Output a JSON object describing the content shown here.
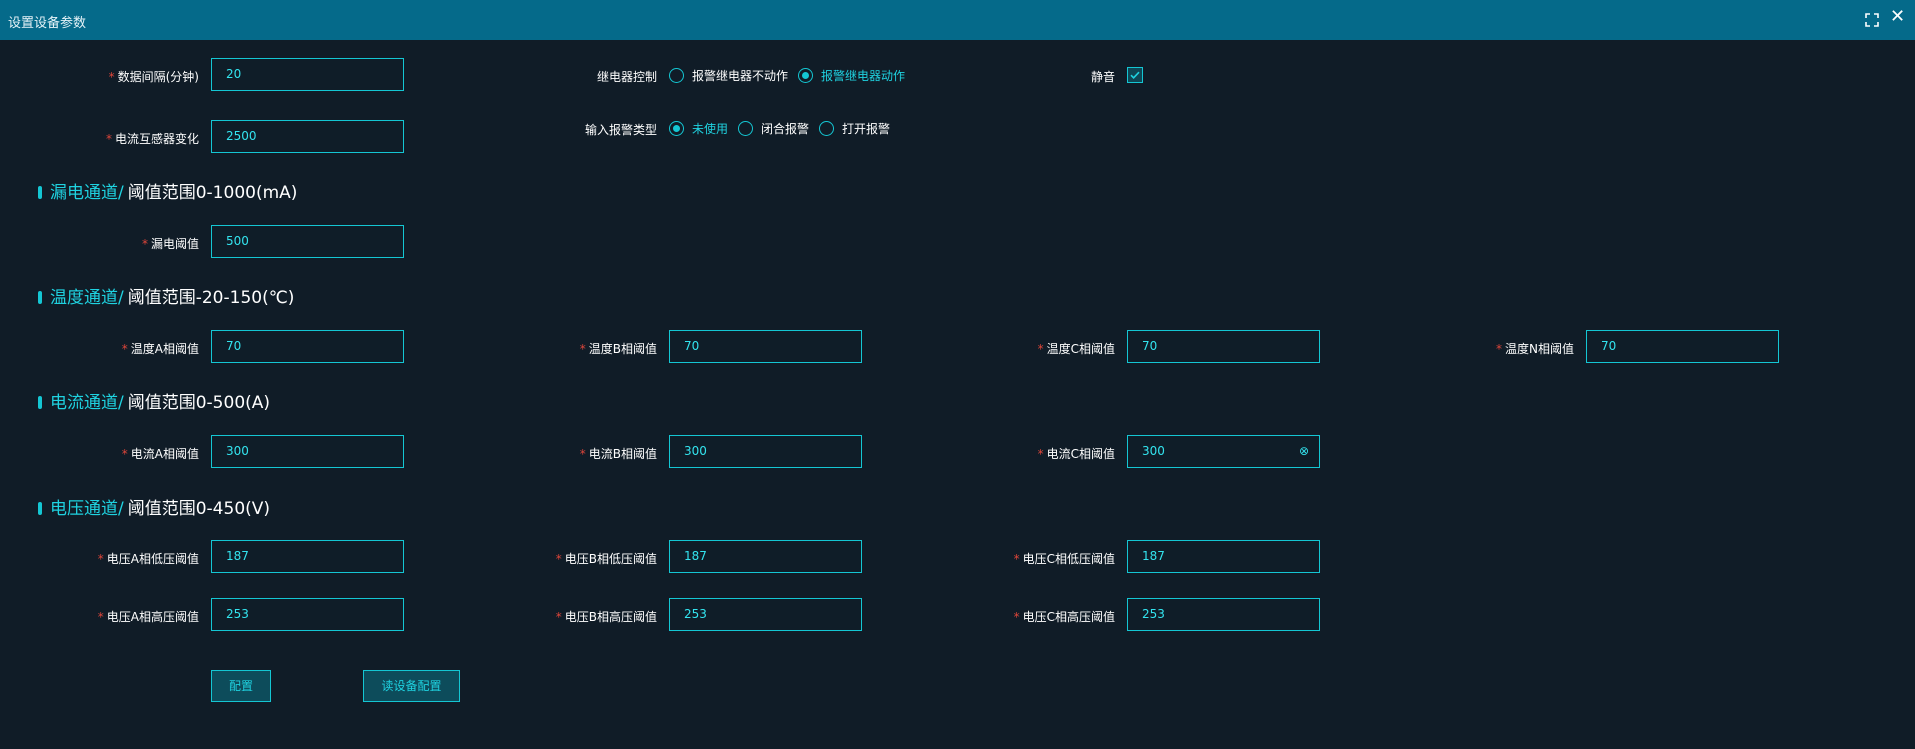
{
  "window": {
    "title": "设置设备参数",
    "fullscreen_icon": "fullscreen-icon",
    "close_icon": "close-icon",
    "close_glyph": "✕"
  },
  "general": {
    "data_interval": {
      "label": "数据间隔(分钟)",
      "value": "20"
    },
    "ct_ratio": {
      "label": "电流互感器变化",
      "value": "2500"
    },
    "relay_control": {
      "label": "继电器控制",
      "options": [
        "报警继电器不动作",
        "报警继电器动作"
      ],
      "selected": "报警继电器动作"
    },
    "mute": {
      "label": "静音",
      "checked": true
    },
    "input_alarm_type": {
      "label": "输入报警类型",
      "options": [
        "未使用",
        "闭合报警",
        "打开报警"
      ],
      "selected": "未使用"
    }
  },
  "leakage": {
    "title": "漏电通道/",
    "range": "阈值范围0-1000(mA)",
    "threshold": {
      "label": "漏电阈值",
      "value": "500"
    }
  },
  "temperature": {
    "title": "温度通道/",
    "range": "阈值范围-20-150(℃)",
    "a": {
      "label": "温度A相阈值",
      "value": "70"
    },
    "b": {
      "label": "温度B相阈值",
      "value": "70"
    },
    "c": {
      "label": "温度C相阈值",
      "value": "70"
    },
    "n": {
      "label": "温度N相阈值",
      "value": "70"
    }
  },
  "current": {
    "title": "电流通道/",
    "range": "阈值范围0-500(A)",
    "a": {
      "label": "电流A相阈值",
      "value": "300"
    },
    "b": {
      "label": "电流B相阈值",
      "value": "300"
    },
    "c": {
      "label": "电流C相阈值",
      "value": "300",
      "clear_glyph": "⊗"
    }
  },
  "voltage": {
    "title": "电压通道/",
    "range": "阈值范围0-450(V)",
    "a_low": {
      "label": "电压A相低压阈值",
      "value": "187"
    },
    "b_low": {
      "label": "电压B相低压阈值",
      "value": "187"
    },
    "c_low": {
      "label": "电压C相低压阈值",
      "value": "187"
    },
    "a_high": {
      "label": "电压A相高压阈值",
      "value": "253"
    },
    "b_high": {
      "label": "电压B相高压阈值",
      "value": "253"
    },
    "c_high": {
      "label": "电压C相高压阈值",
      "value": "253"
    }
  },
  "actions": {
    "configure": "配置",
    "read_config": "读设备配置"
  },
  "colors": {
    "background": "#101c27",
    "titlebar": "#056a8a",
    "accent": "#14c6d3",
    "required": "#e0463a"
  }
}
